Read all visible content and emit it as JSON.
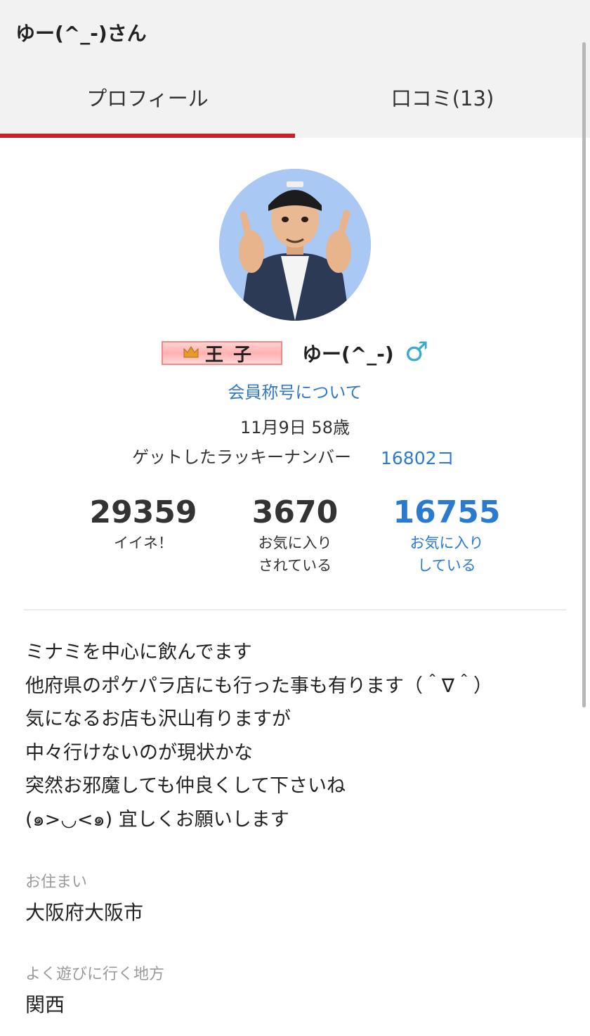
{
  "header": {
    "title": "ゆー(^_-)さん"
  },
  "tabs": [
    {
      "label": "プロフィール",
      "active": true
    },
    {
      "label": "口コミ(13)",
      "active": false
    }
  ],
  "profile": {
    "rank_badge": "王子",
    "username": "ゆー(^_-)",
    "gender_symbol": "♂",
    "member_title_link": "会員称号について",
    "birthday": "11月9日 58歳",
    "lucky_label": "ゲットしたラッキーナンバー",
    "lucky_value": "16802コ"
  },
  "stats": [
    {
      "value": "29359",
      "label1": "イイネ！",
      "label2": ""
    },
    {
      "value": "3670",
      "label1": "お気に入り",
      "label2": "されている"
    },
    {
      "value": "16755",
      "label1": "お気に入り",
      "label2": "している"
    }
  ],
  "bio": [
    "ミナミを中心に飲んでます",
    "他府県のポケパラ店にも行った事も有ります（＾∇＾）",
    "気になるお店も沢山有りますが",
    "中々行けないのが現状かな",
    "突然お邪魔しても仲良くして下さいね",
    "(๑>◡<๑) 宜しくお願いします"
  ],
  "fields": [
    {
      "label": "お住まい",
      "value": "大阪府大阪市"
    },
    {
      "label": "よく遊びに行く地方",
      "value": "関西"
    }
  ],
  "colors": {
    "accent_red": "#c8202a",
    "link_blue": "#2a7bd0",
    "gender_blue": "#39a9d6"
  }
}
